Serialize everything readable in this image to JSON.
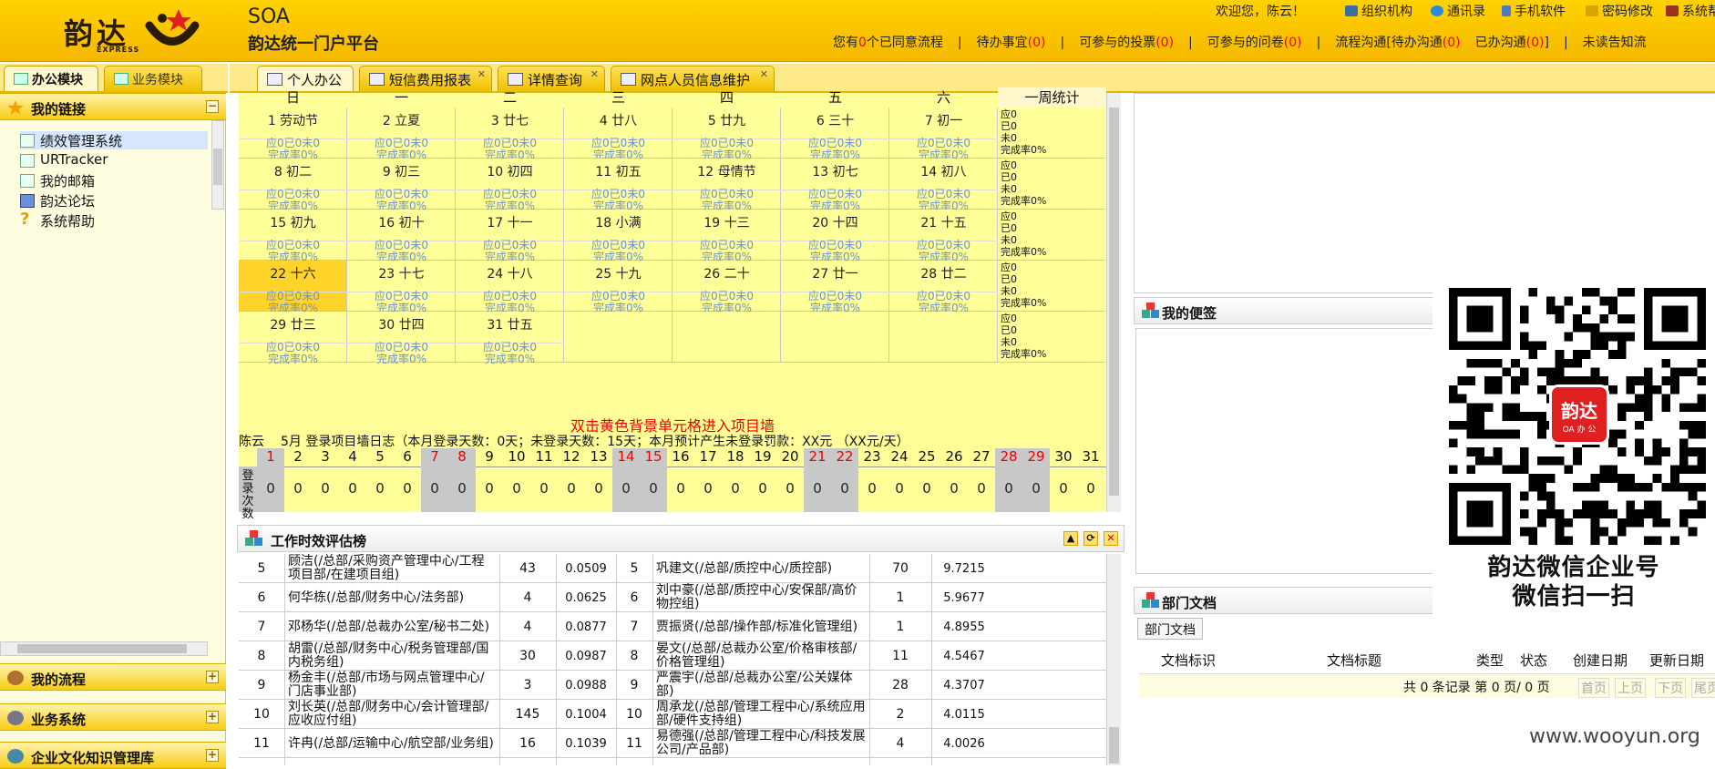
{
  "header": {
    "logo_text": "韵达",
    "logo_sub": "EXPRESS",
    "app_title": "SOA",
    "app_subtitle": "韵达统一门户平台",
    "welcome": "欢迎您，陈云！",
    "top_links": [
      {
        "label": "组织机构",
        "color": "#3a6ea5"
      },
      {
        "label": "通讯录",
        "color": "#2b8ad8"
      },
      {
        "label": "手机软件",
        "color": "#4a7ac0"
      },
      {
        "label": "密码修改",
        "color": "#d9a400"
      },
      {
        "label": "系统帮",
        "color": "#9a3020"
      }
    ],
    "status": {
      "pending_prefix": "您有",
      "pending_count": "0",
      "pending_suffix": "个已同意流程",
      "todo": "待办事宜",
      "todo_count": "(0)",
      "vote": "可参与的投票",
      "vote_count": "(0)",
      "survey": "可参与的问卷",
      "survey_count": "(0)",
      "flow": "流程沟通[待办沟通",
      "flow_count": "(0)",
      "done": "已办沟通",
      "done_count": "(0)",
      "done_close": "]",
      "unread": "未读告知流"
    }
  },
  "left": {
    "tabs": [
      "办公模块",
      "业务模块"
    ],
    "sections": {
      "links_title": "我的链接",
      "flow_title": "我的流程",
      "biz_title": "业务系统",
      "kb_title": "企业文化知识管理库"
    },
    "links": [
      "绩效管理系统",
      "URTracker",
      "我的邮箱",
      "韵达论坛",
      "系统帮助"
    ]
  },
  "tabs": [
    {
      "label": "个人办公",
      "active": true
    },
    {
      "label": "短信费用报表"
    },
    {
      "label": "详情查询"
    },
    {
      "label": "网点人员信息维护"
    }
  ],
  "calendar": {
    "weekdays": [
      "日",
      "一",
      "二",
      "三",
      "四",
      "五",
      "六"
    ],
    "week_stat_header": "一周统计",
    "stat_line1": "应0已0未0",
    "stat_line2": "完成率0%",
    "week_stat": [
      "应0",
      "已0",
      "未0",
      "完成率0%"
    ],
    "weeks": [
      [
        "1 劳动节",
        "2 立夏",
        "3 廿七",
        "4 廿八",
        "5 廿九",
        "6 三十",
        "7 初一"
      ],
      [
        "8 初二",
        "9 初三",
        "10 初四",
        "11 初五",
        "12 母情节",
        "13 初七",
        "14 初八"
      ],
      [
        "15 初九",
        "16 初十",
        "17 十一",
        "18 小满",
        "19 十三",
        "20 十四",
        "21 十五"
      ],
      [
        "22 十六",
        "23 十七",
        "24 十八",
        "25 十九",
        "26 二十",
        "27 廿一",
        "28 廿二"
      ],
      [
        "29 廿三",
        "30 廿四",
        "31 廿五",
        "",
        "",
        "",
        ""
      ]
    ],
    "today_label": "22 十六",
    "hint": "双击黄色背景单元格进入项目墙",
    "log": {
      "user": "陈云",
      "month_title": "5月 登录项目墙日志（本月登录天数：0天；未登录天数：15天；本月预计产生未登录罚款：XX元 （XX元/天）"
    },
    "login_label": "登录次数",
    "days": [
      "1",
      "2",
      "3",
      "4",
      "5",
      "6",
      "7",
      "8",
      "9",
      "10",
      "11",
      "12",
      "13",
      "14",
      "15",
      "16",
      "17",
      "18",
      "19",
      "20",
      "21",
      "22",
      "23",
      "24",
      "25",
      "26",
      "27",
      "28",
      "29",
      "30",
      "31"
    ],
    "weekend_days": [
      "1",
      "7",
      "8",
      "14",
      "15",
      "21",
      "22",
      "28",
      "29"
    ],
    "counts": [
      "0",
      "0",
      "0",
      "0",
      "0",
      "0",
      "0",
      "0",
      "0",
      "0",
      "0",
      "0",
      "0",
      "0",
      "0",
      "0",
      "0",
      "0",
      "0",
      "0",
      "0",
      "0",
      "0",
      "0",
      "0",
      "0",
      "0",
      "0",
      "0",
      "0",
      "0"
    ]
  },
  "work": {
    "title": "工作时效评估榜",
    "left_rows": [
      {
        "rank": "5",
        "name": "顾洁(/总部/采购资产管理中心/工程项目部/在建项目组)",
        "count": "43",
        "score": "0.0509"
      },
      {
        "rank": "6",
        "name": "何华栋(/总部/财务中心/法务部)",
        "count": "4",
        "score": "0.0625"
      },
      {
        "rank": "7",
        "name": "邓杨华(/总部/总裁办公室/秘书二处)",
        "count": "4",
        "score": "0.0877"
      },
      {
        "rank": "8",
        "name": "胡雷(/总部/财务中心/税务管理部/国内税务组)",
        "count": "30",
        "score": "0.0987"
      },
      {
        "rank": "9",
        "name": "杨金丰(/总部/市场与网点管理中心/门店事业部)",
        "count": "3",
        "score": "0.0988"
      },
      {
        "rank": "10",
        "name": "刘长英(/总部/财务中心/会计管理部/应收应付组)",
        "count": "145",
        "score": "0.1004"
      },
      {
        "rank": "11",
        "name": "许冉(/总部/运输中心/航空部/业务组)",
        "count": "16",
        "score": "0.1039"
      }
    ],
    "right_rows": [
      {
        "rank": "5",
        "name": "巩建文(/总部/质控中心/质控部)",
        "count": "70",
        "score": "9.7215"
      },
      {
        "rank": "6",
        "name": "刘中豪(/总部/质控中心/安保部/高价物控组)",
        "count": "1",
        "score": "5.9677"
      },
      {
        "rank": "7",
        "name": "贾振贤(/总部/操作部/标准化管理组)",
        "count": "1",
        "score": "4.8955"
      },
      {
        "rank": "8",
        "name": "晏文(/总部/总裁办公室/价格审核部/价格管理组)",
        "count": "11",
        "score": "4.5467"
      },
      {
        "rank": "9",
        "name": "严震宇(/总部/总裁办公室/公关媒体部)",
        "count": "28",
        "score": "4.3707"
      },
      {
        "rank": "10",
        "name": "周承龙(/总部/管理工程中心/系统应用部/硬件支持组)",
        "count": "2",
        "score": "4.0115"
      },
      {
        "rank": "11",
        "name": "易德强(/总部/管理工程中心/科技发展公司/产品部)",
        "count": "4",
        "score": "4.0026"
      }
    ]
  },
  "notes": {
    "title": "我的便签"
  },
  "dept": {
    "title": "部门文档",
    "tab": "部门文档",
    "columns": [
      "文档标识",
      "文档标题",
      "类型",
      "状态",
      "创建日期",
      "更新日期"
    ],
    "pager": {
      "info": "共 0 条记录 第 0 页/ 0 页",
      "first": "首页",
      "prev": "上页",
      "next": "下页",
      "last": "尾页"
    }
  },
  "qr": {
    "badge_title": "韵达",
    "badge_sub": "OA 办 公",
    "caption1": "韵达微信企业号",
    "caption2": "微信扫一扫"
  },
  "watermark": "www.wooyun.org",
  "colors": {
    "header": "#ffd200",
    "calendar_cell": "#ffff99",
    "today": "#ffd42a",
    "weekend": "#c8c8c8",
    "stat_text": "#6f93c6",
    "hint": "#e00000"
  }
}
